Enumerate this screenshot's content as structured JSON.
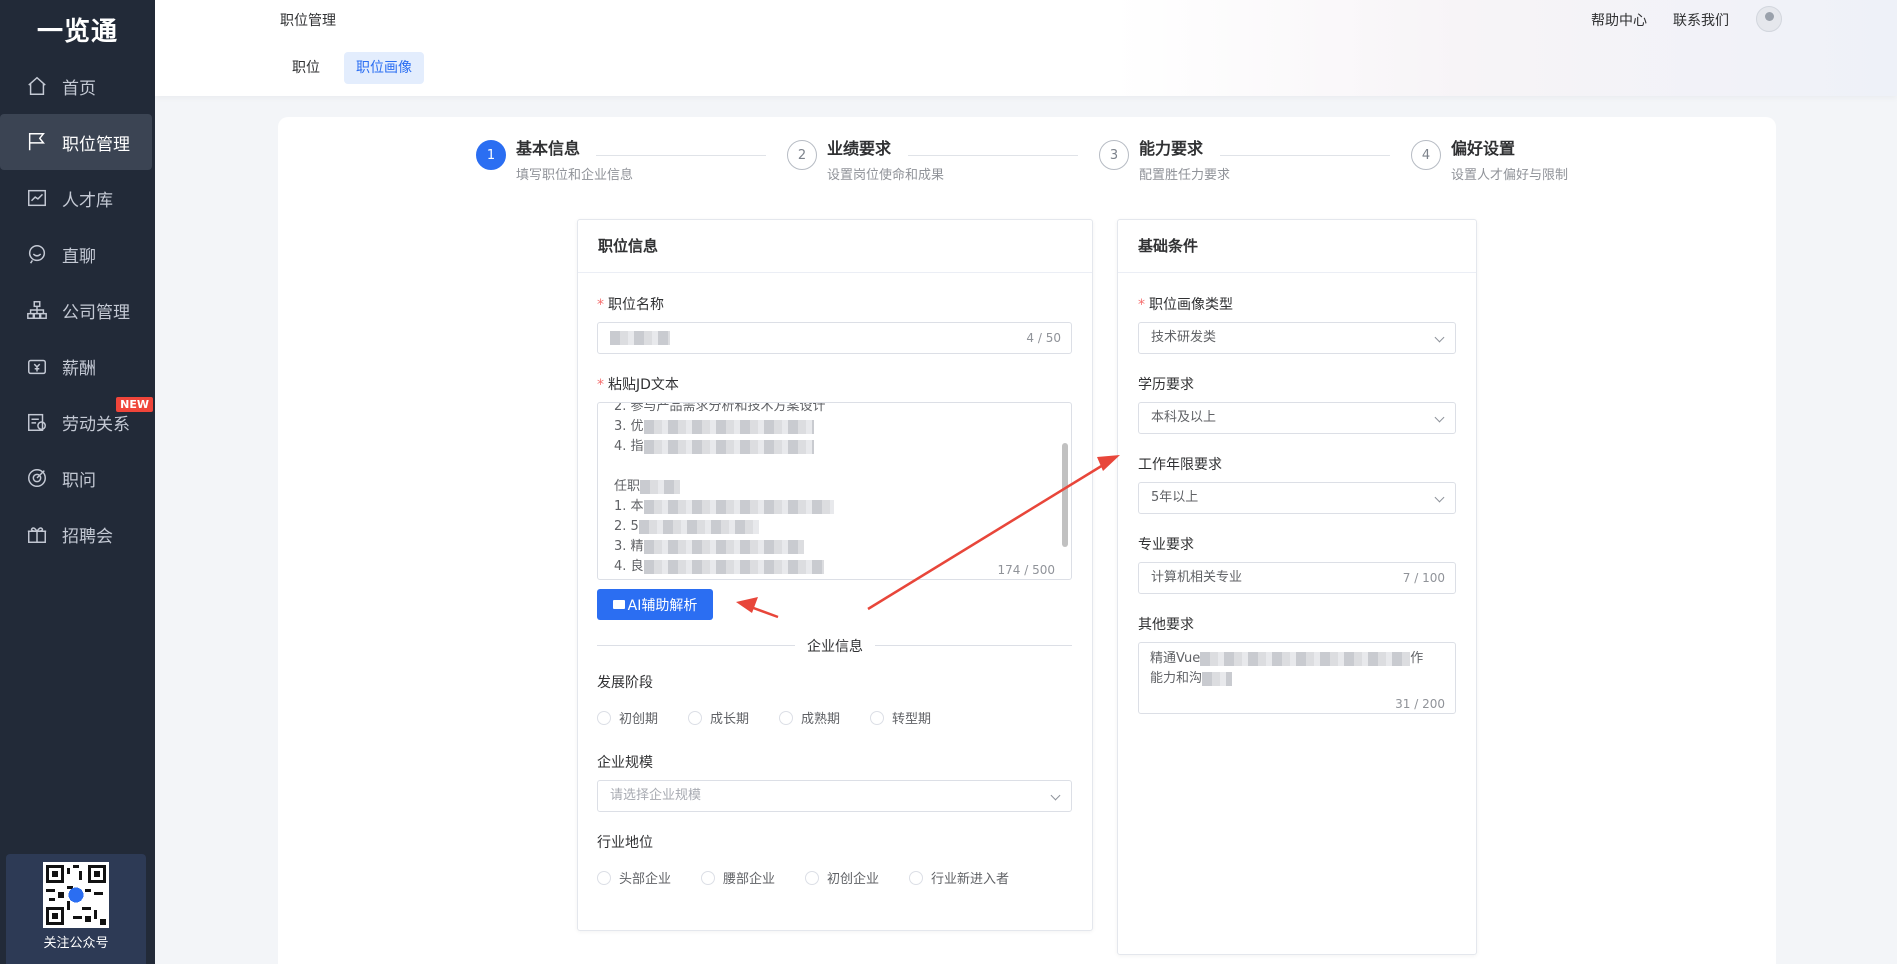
{
  "app": {
    "logo": "一览通"
  },
  "sidebar": {
    "items": [
      {
        "label": "首页",
        "icon": "home-icon"
      },
      {
        "label": "职位管理",
        "icon": "flag-icon",
        "active": true
      },
      {
        "label": "人才库",
        "icon": "chart-line-icon"
      },
      {
        "label": "直聊",
        "icon": "chat-icon"
      },
      {
        "label": "公司管理",
        "icon": "org-chart-icon"
      },
      {
        "label": "薪酬",
        "icon": "wallet-icon"
      },
      {
        "label": "劳动关系",
        "icon": "contract-icon",
        "badge": "NEW"
      },
      {
        "label": "职问",
        "icon": "target-icon"
      },
      {
        "label": "招聘会",
        "icon": "gift-icon"
      }
    ],
    "qr_label": "关注公众号"
  },
  "header": {
    "breadcrumb": "职位管理",
    "help": "帮助中心",
    "contact": "联系我们",
    "tabs": [
      {
        "label": "职位"
      },
      {
        "label": "职位画像",
        "active": true
      }
    ]
  },
  "steps": [
    {
      "num": "1",
      "title": "基本信息",
      "desc": "填写职位和企业信息",
      "active": true
    },
    {
      "num": "2",
      "title": "业绩要求",
      "desc": "设置岗位使命和成果"
    },
    {
      "num": "3",
      "title": "能力要求",
      "desc": "配置胜任力要求"
    },
    {
      "num": "4",
      "title": "偏好设置",
      "desc": "设置人才偏好与限制"
    }
  ],
  "job_card": {
    "title": "职位信息",
    "name_label": "职位名称",
    "name_count": "4 / 50",
    "jd_label": "粘贴JD文本",
    "jd_lines": [
      "2. 参与产品需求分析和技术方案设计",
      "3. 优",
      "4. 指",
      "",
      "任职",
      "1. 本",
      "2. 5",
      "3. 精",
      "4. 良"
    ],
    "jd_count": "174 / 500",
    "ai_button": "AI辅助解析",
    "company_divider": "企业信息",
    "stage_label": "发展阶段",
    "stage_options": [
      "初创期",
      "成长期",
      "成熟期",
      "转型期"
    ],
    "scale_label": "企业规模",
    "scale_placeholder": "请选择企业规模",
    "position_label": "行业地位",
    "position_options": [
      "头部企业",
      "腰部企业",
      "初创企业",
      "行业新进入者"
    ]
  },
  "basic_card": {
    "title": "基础条件",
    "type_label": "职位画像类型",
    "type_value": "技术研发类",
    "edu_label": "学历要求",
    "edu_value": "本科及以上",
    "years_label": "工作年限要求",
    "years_value": "5年以上",
    "major_label": "专业要求",
    "major_value": "计算机相关专业",
    "major_count": "7 / 100",
    "other_label": "其他要求",
    "other_line1": "精通Vue",
    "other_line1_end": "作",
    "other_line2": "能力和沟",
    "other_count": "31 / 200"
  },
  "colors": {
    "primary": "#2b6ef2",
    "sidebar": "#222a38",
    "arrow": "#e8463a"
  }
}
